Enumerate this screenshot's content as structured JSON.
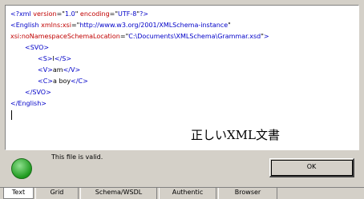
{
  "editor": {
    "lines": [
      {
        "indent": 0,
        "parts": [
          {
            "c": "t",
            "s": "<?xml "
          },
          {
            "c": "a",
            "s": "version"
          },
          {
            "c": "q",
            "s": "=\""
          },
          {
            "c": "v",
            "s": "1.0"
          },
          {
            "c": "q",
            "s": "\" "
          },
          {
            "c": "a",
            "s": "encoding"
          },
          {
            "c": "q",
            "s": "=\""
          },
          {
            "c": "v",
            "s": "UTF-8"
          },
          {
            "c": "q",
            "s": "\""
          },
          {
            "c": "t",
            "s": "?>"
          }
        ]
      },
      {
        "indent": 0,
        "parts": [
          {
            "c": "t",
            "s": "<English "
          },
          {
            "c": "a",
            "s": "xmlns:xsi"
          },
          {
            "c": "q",
            "s": "=\""
          },
          {
            "c": "v",
            "s": "http://www.w3.org/2001/XMLSchema-instance"
          },
          {
            "c": "q",
            "s": "\""
          }
        ]
      },
      {
        "indent": 0,
        "parts": [
          {
            "c": "a",
            "s": "xsi:noNamespaceSchemaLocation"
          },
          {
            "c": "q",
            "s": "=\""
          },
          {
            "c": "v",
            "s": "C:\\Documents\\XMLSchema\\Grammar.xsd"
          },
          {
            "c": "q",
            "s": "\""
          },
          {
            "c": "t",
            "s": ">"
          }
        ]
      },
      {
        "indent": 1,
        "parts": [
          {
            "c": "t",
            "s": "<SVO>"
          }
        ]
      },
      {
        "indent": 2,
        "parts": [
          {
            "c": "t",
            "s": "<S>"
          },
          {
            "c": "txt",
            "s": "I"
          },
          {
            "c": "t",
            "s": "</S>"
          }
        ]
      },
      {
        "indent": 2,
        "parts": [
          {
            "c": "t",
            "s": "<V>"
          },
          {
            "c": "txt",
            "s": "am"
          },
          {
            "c": "t",
            "s": "</V>"
          }
        ]
      },
      {
        "indent": 2,
        "parts": [
          {
            "c": "t",
            "s": "<C>"
          },
          {
            "c": "txt",
            "s": "a boy"
          },
          {
            "c": "t",
            "s": "</C>"
          }
        ]
      },
      {
        "indent": 1,
        "parts": [
          {
            "c": "t",
            "s": "</SVO>"
          }
        ]
      },
      {
        "indent": 0,
        "parts": [
          {
            "c": "t",
            "s": "</English>"
          }
        ]
      }
    ]
  },
  "caption": "正しいXML文書",
  "status": {
    "message": "This file is valid.",
    "ok_label": "OK"
  },
  "tabs": [
    {
      "label": "Text",
      "active": true
    },
    {
      "label": "Grid",
      "active": false
    },
    {
      "label": "Schema/WSDL",
      "active": false
    },
    {
      "label": "Authentic",
      "active": false
    },
    {
      "label": "Browser",
      "active": false
    }
  ],
  "colors": {
    "tag": "#0000c8",
    "attribute": "#c00000",
    "valid_icon": "#1f9a1f"
  },
  "icons": {
    "valid": "check-circle-icon"
  }
}
